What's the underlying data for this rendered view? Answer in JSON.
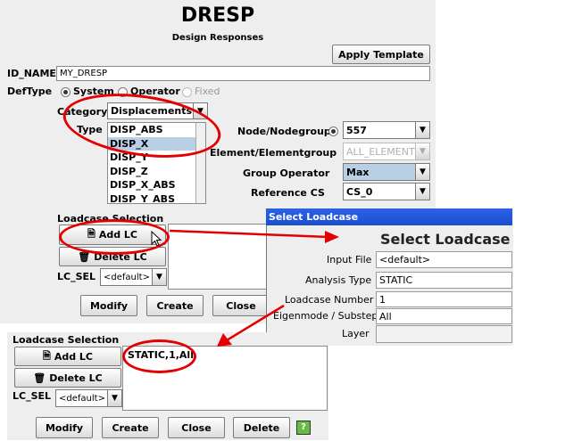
{
  "main": {
    "title": "DRESP",
    "subtitle": "Design Responses",
    "apply_template": "Apply Template",
    "id_name_label": "ID_NAME",
    "id_name_value": "MY_DRESP",
    "deftype_label": "DefType",
    "deftype_options": [
      "System",
      "Operator",
      "Fixed"
    ],
    "category_label": "Category",
    "category_value": "Displacements",
    "type_label": "Type",
    "type_items": [
      "DISP_ABS",
      "DISP_X",
      "DISP_Y",
      "DISP_Z",
      "DISP_X_ABS",
      "DISP_Y_ABS"
    ],
    "type_selected_index": 1,
    "node_label": "Node/Nodegroup",
    "node_value": "557",
    "element_label": "Element/Elementgroup",
    "element_value": "ALL_ELEMENTS",
    "group_operator_label": "Group Operator",
    "group_operator_value": "Max",
    "reference_cs_label": "Reference CS",
    "reference_cs_value": "CS_0",
    "loadcase_selection_label": "Loadcase Selection",
    "add_lc": "Add LC",
    "delete_lc": "Delete LC",
    "lc_sel_label": "LC_SEL",
    "lc_sel_value": "<default>",
    "modify": "Modify",
    "create": "Create",
    "close": "Close"
  },
  "dialog": {
    "window_title": "Select Loadcase",
    "heading": "Select Loadcase",
    "input_file_label": "Input File",
    "input_file_value": "<default>",
    "analysis_type_label": "Analysis Type",
    "analysis_type_value": "STATIC",
    "loadcase_number_label": "Loadcase Number",
    "loadcase_number_value": "1",
    "eigenmode_label": "Eigenmode / Substep",
    "eigenmode_value": "All",
    "layer_label": "Layer",
    "layer_value": ""
  },
  "bottom": {
    "loadcase_selection_label": "Loadcase Selection",
    "add_lc": "Add LC",
    "delete_lc": "Delete LC",
    "lc_sel_label": "LC_SEL",
    "lc_sel_value": "<default>",
    "lc_entry": "STATIC,1,All",
    "modify": "Modify",
    "create": "Create",
    "close": "Close",
    "delete": "Delete"
  },
  "colors": {
    "annotation": "#e40000",
    "dialog_title_bar": "#1c4fcf",
    "selection": "#b8cfe5"
  },
  "icons": [
    "cursor-arrow-icon",
    "document-add-icon",
    "trash-icon",
    "help-icon"
  ]
}
